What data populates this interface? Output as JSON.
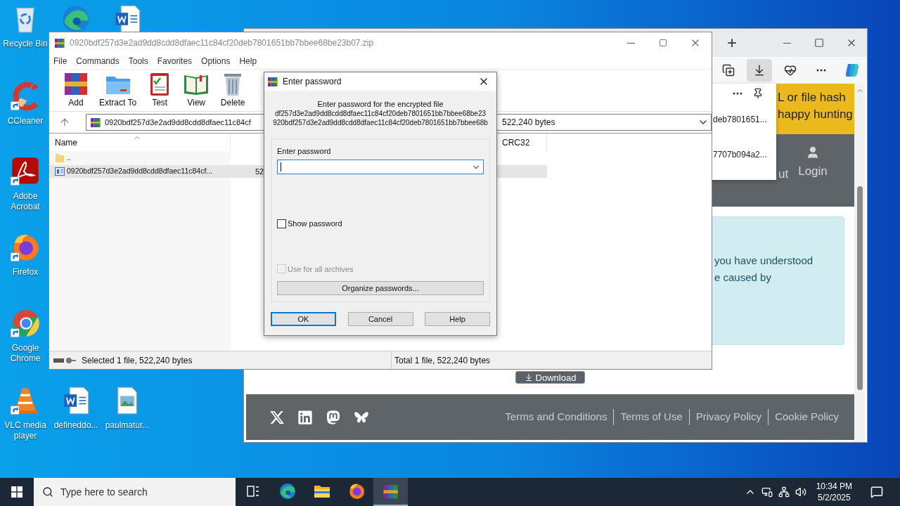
{
  "desktop_icons": [
    {
      "kind": "recycle",
      "label": "Recycle Bin"
    },
    {
      "kind": "edge"
    },
    {
      "kind": "word"
    },
    {
      "kind": "ccleaner",
      "label": "CCleaner"
    },
    {
      "kind": "acrobat",
      "label": "Adobe Acrobat"
    },
    {
      "kind": "firefox",
      "label": "Firefox"
    },
    {
      "kind": "chrome",
      "label": "Google Chrome"
    },
    {
      "kind": "vlc",
      "label": "VLC media player"
    },
    {
      "kind": "word",
      "label": "defineddo..."
    },
    {
      "kind": "image",
      "label": "paulmatur..."
    }
  ],
  "browser": {
    "new_tab": "+",
    "toolbar": [
      {
        "kind": "collections",
        "selected": false
      },
      {
        "kind": "downloads",
        "selected": true
      },
      {
        "kind": "health",
        "selected": false
      },
      {
        "kind": "more",
        "selected": false
      },
      {
        "kind": "copilot",
        "selected": false
      }
    ],
    "downloads_panel": {
      "items": [
        "deb7801651...",
        "7707b094a2..."
      ]
    },
    "banner": [
      "L or file hash",
      "happy hunting"
    ],
    "nav": [
      {
        "kind": "text",
        "label": "ut"
      },
      {
        "kind": "user",
        "label": "Login"
      }
    ],
    "notice": [
      "you have understood",
      "e caused by"
    ],
    "download_button": "Download",
    "footer": {
      "social": [
        {
          "kind": "x"
        },
        {
          "kind": "linkedin"
        },
        {
          "kind": "mastodon"
        },
        {
          "kind": "bluesky"
        }
      ],
      "links": [
        "Terms and Conditions",
        "Terms of Use",
        "Privacy Policy",
        "Cookie Policy"
      ]
    }
  },
  "winrar": {
    "title": "0920bdf257d3e2ad9dd8cdd8dfaec11c84cf20deb7801651bb7bbee68be23b07.zip",
    "menu": [
      "File",
      "Commands",
      "Tools",
      "Favorites",
      "Options",
      "Help"
    ],
    "toolbar": [
      {
        "kind": "add",
        "label": "Add"
      },
      {
        "kind": "extract",
        "label": "Extract To"
      },
      {
        "kind": "test",
        "label": "Test"
      },
      {
        "kind": "view",
        "label": "View"
      },
      {
        "kind": "delete",
        "label": "Delete"
      }
    ],
    "address": "0920bdf257d3e2ad9dd8cdd8dfaec11c84cf",
    "address_tail": "522,240 bytes",
    "columns": [
      "Name",
      "CRC32"
    ],
    "files": [
      {
        "kind": "folder",
        "name": "..",
        "selected": false
      },
      {
        "kind": "file",
        "name": "0920bdf257d3e2ad9dd8cdd8dfaec11c84cf...",
        "size": "52",
        "selected": true
      }
    ],
    "status_left": "Selected 1 file, 522,240 bytes",
    "status_right": "Total 1 file, 522,240 bytes"
  },
  "dialog": {
    "title": "Enter password",
    "message": "Enter password for the encrypted file",
    "file_lines": [
      "df257d3e2ad9dd8cdd8dfaec11c84cf20deb7801651bb7bbee68be23",
      "920bdf257d3e2ad9dd8cdd8dfaec11c84cf20deb7801651bb7bbee68b"
    ],
    "field_label": "Enter password",
    "show_password": {
      "label": "Show password",
      "checked": false
    },
    "use_for_all": {
      "label": "Use for all archives",
      "checked": false,
      "disabled": true
    },
    "organize": "Organize passwords...",
    "buttons": [
      {
        "label": "OK",
        "focused": true
      },
      {
        "label": "Cancel",
        "focused": false
      },
      {
        "label": "Help",
        "focused": false
      }
    ]
  },
  "taskbar": {
    "search_placeholder": "Type here to search",
    "apps": [
      {
        "kind": "taskview",
        "selected": false
      },
      {
        "kind": "edge",
        "selected": false
      },
      {
        "kind": "explorer",
        "selected": false
      },
      {
        "kind": "firefox",
        "selected": false
      },
      {
        "kind": "winrar",
        "selected": true
      }
    ],
    "time": "10:34 PM",
    "date": "5/2/2025"
  }
}
